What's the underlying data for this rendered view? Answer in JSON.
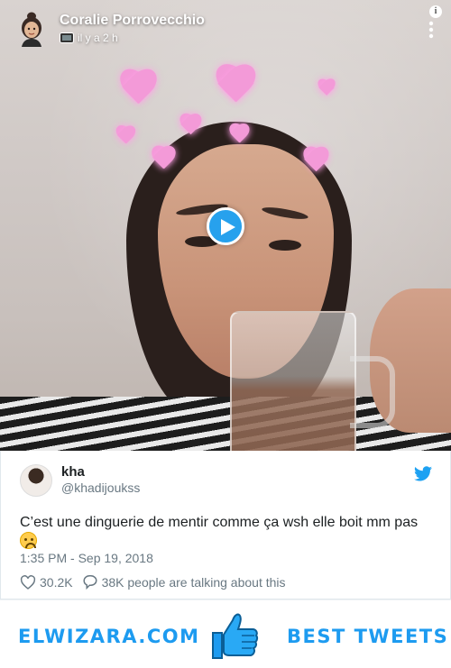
{
  "snap": {
    "user_name": "Coralie Porrovecchio",
    "time_ago": "il y a 2 h"
  },
  "video": {
    "play_icon": "play-icon",
    "play_color": "#1DA1F2"
  },
  "tweet": {
    "name": "kha",
    "handle": "@khadijoukss",
    "text": "C’est une dinguerie de mentir comme ça wsh elle boit mm pas",
    "emoji": "loudly-crying-face-emoji",
    "datetime": "1:35 PM - Sep 19, 2018",
    "likes": "30.2K",
    "talking": "38K people are talking about this"
  },
  "banner": {
    "site": "ELWIZARA.COM",
    "label": "BEST TWEETS",
    "accent_color": "#1D9BF0"
  }
}
